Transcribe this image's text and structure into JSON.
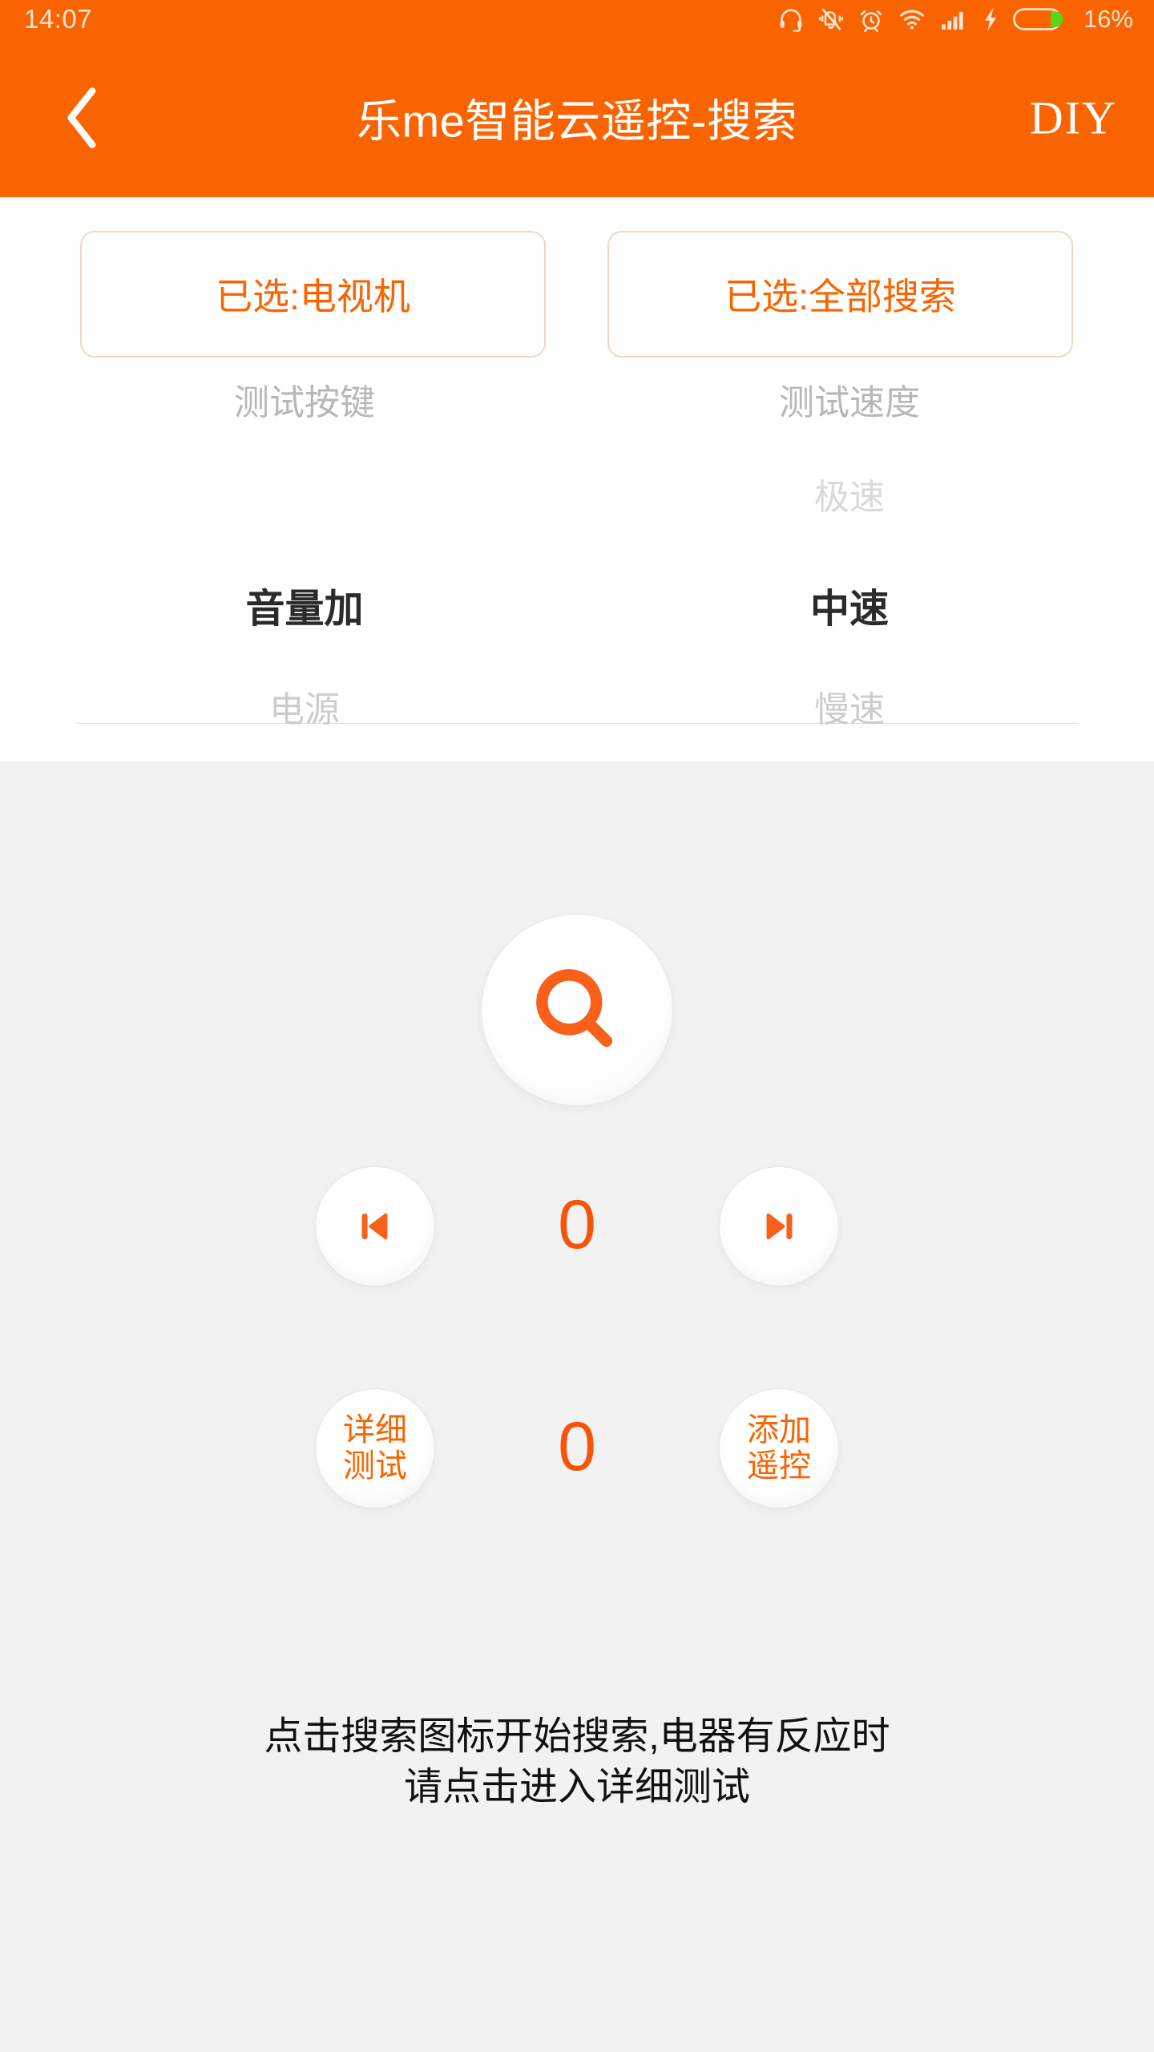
{
  "theme": {
    "brand": "#fa6400",
    "accent_text": "#f96019",
    "counter_color": "#f4550b",
    "panel_bg": "#ffffff",
    "body_bg": "#f2f2f2"
  },
  "statusbar": {
    "time": "14:07",
    "battery_percent": "16%",
    "icons": [
      "headset-icon",
      "bell-muted-icon",
      "alarm-clock-icon",
      "wifi-icon",
      "signal-bars-icon",
      "charging-bolt-icon",
      "battery-icon"
    ]
  },
  "header": {
    "back_label": "‹",
    "title": "乐me智能云遥控-搜索",
    "diy_label": "DIY"
  },
  "selectors": {
    "device": "已选:电视机",
    "scope": "已选:全部搜索"
  },
  "pickers": {
    "key": {
      "header": "测试按键",
      "above": "",
      "selected": "音量加",
      "below": "电源"
    },
    "speed": {
      "header": "测试速度",
      "above": "极速",
      "selected": "中速",
      "below": "慢速"
    }
  },
  "controls": {
    "search_icon": "search-icon",
    "prev_icon": "skip-previous-icon",
    "next_icon": "skip-next-icon",
    "detail_label": "详细\n测试",
    "detail_line1": "详细",
    "detail_line2": "测试",
    "add_line1": "添加",
    "add_line2": "遥控",
    "counter_top": "0",
    "counter_bottom": "0"
  },
  "hint": {
    "line1": "点击搜索图标开始搜索,电器有反应时",
    "line2": "请点击进入详细测试"
  }
}
